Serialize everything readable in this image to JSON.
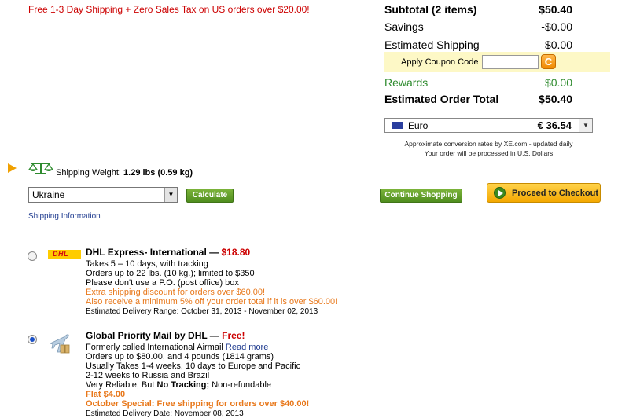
{
  "promo": "Free 1-3 Day Shipping + Zero Sales Tax on US orders over $20.00!",
  "summary": {
    "subtotal_label": "Subtotal (2 items)",
    "subtotal_value": "$50.40",
    "savings_label": "Savings",
    "savings_value": "-$0.00",
    "shipping_label": "Estimated Shipping",
    "shipping_value": "$0.00",
    "coupon_label": "Apply Coupon Code",
    "coupon_placeholder": "",
    "coupon_go": "C",
    "rewards_label": "Rewards",
    "rewards_value": "$0.00",
    "total_label": "Estimated Order Total",
    "total_value": "$50.40"
  },
  "currency": {
    "name": "Euro",
    "value": "€ 36.54"
  },
  "notes": [
    "Approximate conversion rates by XE.com - updated daily",
    "Your order will be processed in U.S. Dollars"
  ],
  "shipping": {
    "weight_label": "Shipping Weight:",
    "weight_value": "1.29 lbs (0.59 kg)",
    "country": "Ukraine",
    "calculate": "Calculate",
    "continue": "Continue Shopping",
    "checkout": "Proceed to Checkout",
    "info_link": "Shipping Information"
  },
  "options": [
    {
      "title": "DHL Express- International —",
      "price": "$18.80",
      "selected": false,
      "logo_text": "DHL",
      "lines": [
        "Takes 5 – 10 days, with tracking",
        "Orders up to 22 lbs. (10 kg.); limited to $350",
        "Please don't use a P.O. (post office) box"
      ],
      "promos": [
        "Extra shipping discount for orders over $60.00!",
        "Also receive a minimum 5% off your order total if it is over $60.00!"
      ],
      "delivery": "Estimated Delivery Range: October 31, 2013 - November 02, 2013"
    },
    {
      "title": "Global Priority Mail by DHL —",
      "price": "Free!",
      "selected": true,
      "line1": "Formerly called International Airmail",
      "read_more": "Read more",
      "lines": [
        "Orders up to $80.00, and 4 pounds (1814 grams)",
        "Usually Takes 1-4 weeks, 10 days to Europe and Pacific",
        "2-12 weeks to Russia and Brazil"
      ],
      "reliable_pre": "Very Reliable, But",
      "reliable_bold": "No Tracking;",
      "reliable_post": "Non-refundable",
      "flat": "Flat $4.00",
      "special": "October Special: Free shipping for orders over $40.00!",
      "delivery": "Estimated Delivery Date: November 08, 2013"
    }
  ]
}
